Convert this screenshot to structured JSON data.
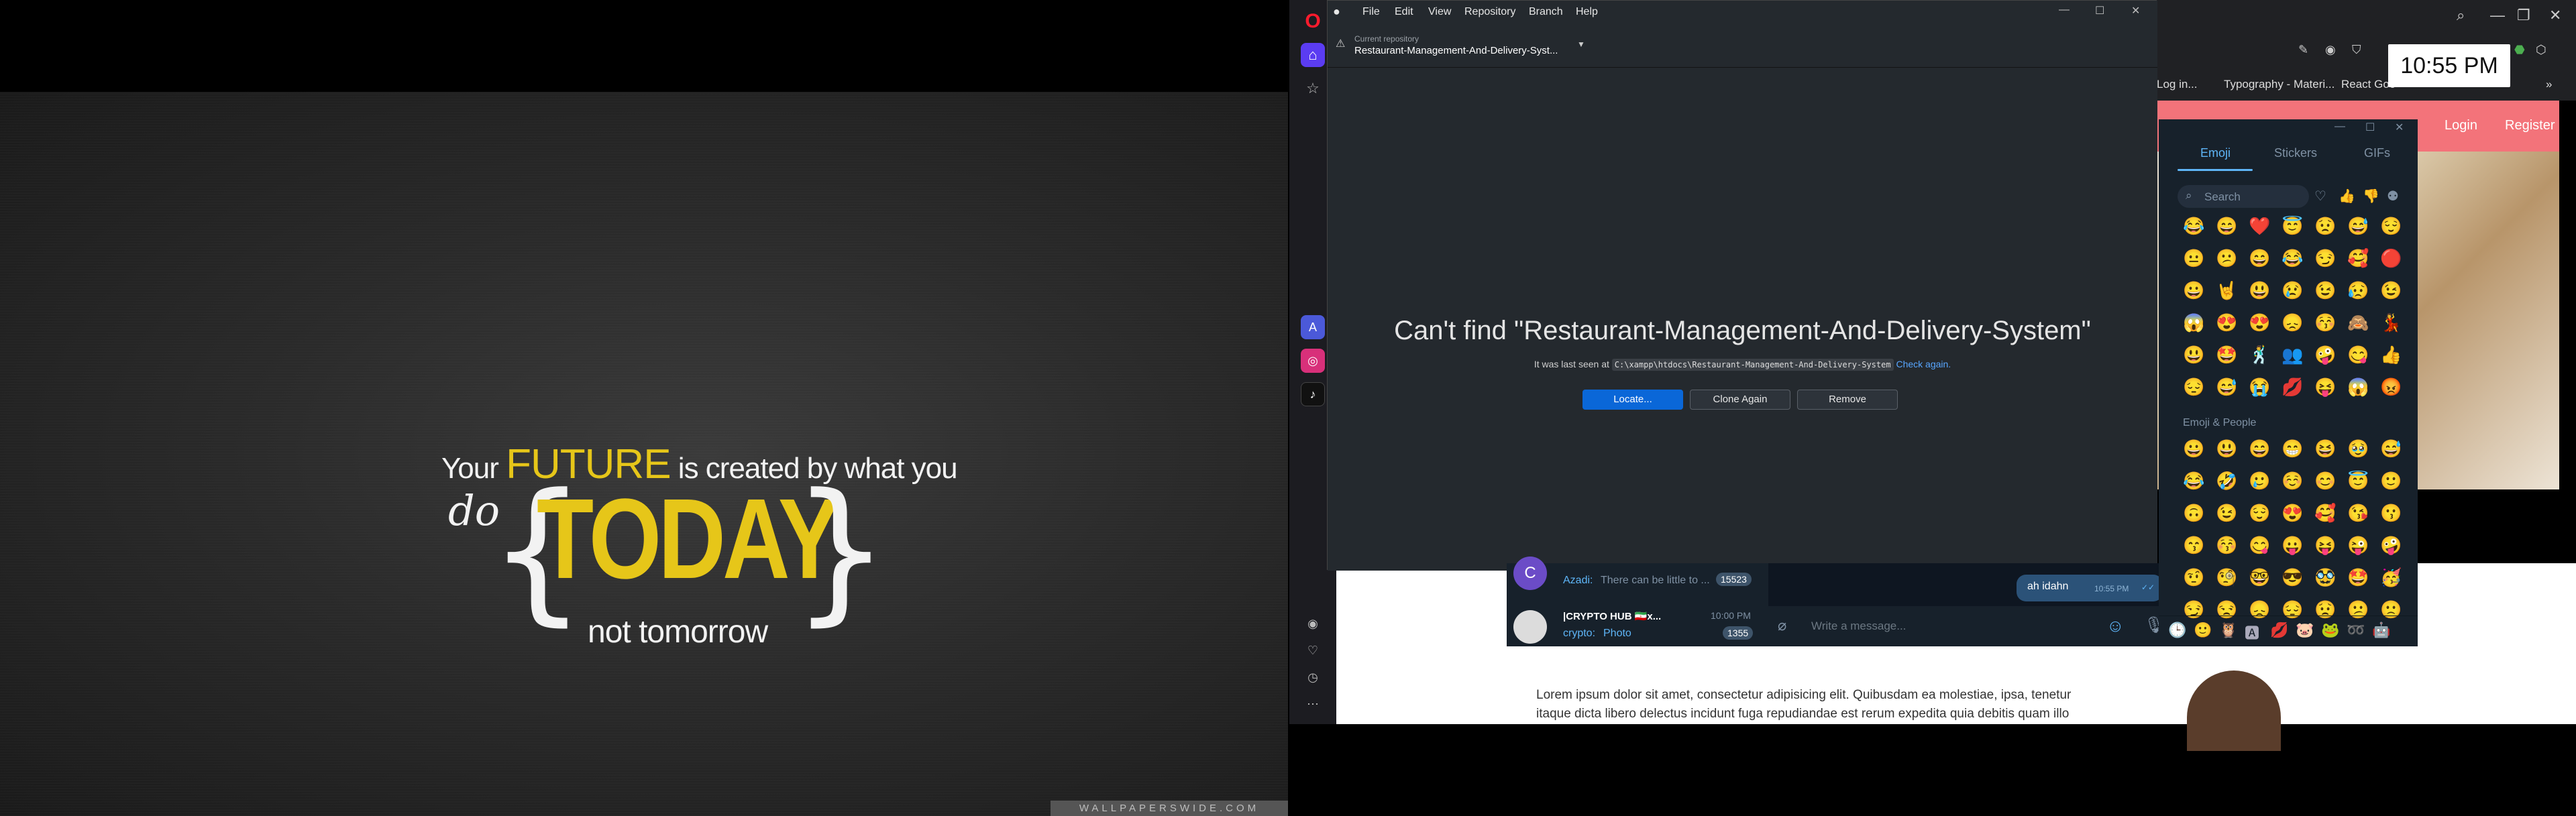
{
  "wallpaper": {
    "line1_a": "Your",
    "line1_highlight": "FUTURE",
    "line1_b": "is created by what you",
    "do": "do",
    "brace_open": "{",
    "today": "TODAY",
    "brace_close": "}",
    "tomorrow": "not tomorrow",
    "watermark": "WALLPAPERSWIDE.COM"
  },
  "github": {
    "menu": [
      "File",
      "Edit",
      "View",
      "Repository",
      "Branch",
      "Help"
    ],
    "current_repo_caption": "Current repository",
    "current_repo_name": "Restaurant-Management-And-Delivery-Syst...",
    "heading": "Can't find \"Restaurant-Management-And-Delivery-System\"",
    "last_seen_prefix": "It was last seen at",
    "last_seen_path": "C:\\xampp\\htdocs\\Restaurant-Management-And-Delivery-System",
    "check_again": "Check again.",
    "buttons": {
      "locate": "Locate...",
      "clone_again": "Clone Again",
      "remove": "Remove"
    }
  },
  "browser": {
    "bookmarks": [
      "Log in...",
      "Typography - Materi...",
      "React Goo"
    ],
    "clock": "10:55 PM",
    "nav": {
      "login": "Login",
      "register": "Register"
    },
    "lorem_line1": "Lorem ipsum dolor sit amet, consectetur adipisicing elit. Quibusdam ea molestiae, ipsa, tenetur",
    "lorem_line2": "itaque dicta libero delectus incidunt fuga repudiandae est rerum expedita quia debitis quam illo"
  },
  "telegram": {
    "chats": [
      {
        "sender": "Azadi:",
        "preview": "There can be little to ...",
        "badge": "15523",
        "avatar_letter": "C"
      },
      {
        "title": "|CRYPTO HUB 🇮🇷x...",
        "time": "10:00 PM",
        "sender": "crypto:",
        "preview": "Photo",
        "badge": "1355"
      }
    ],
    "bubble_text": "ah idahn",
    "bubble_time": "10:55 PM",
    "compose_placeholder": "Write a message..."
  },
  "emoji_panel": {
    "tabs": [
      "Emoji",
      "Stickers",
      "GIFs"
    ],
    "search_placeholder": "Search",
    "section_title": "Emoji & People",
    "recent": [
      "😂",
      "😄",
      "❤️",
      "😇",
      "😟",
      "😅",
      "😌",
      "😐",
      "😕",
      "😄",
      "😂",
      "😏",
      "🥰",
      "🔴",
      "😀",
      "🤘",
      "😃",
      "😢",
      "😉",
      "😥",
      "😉",
      "😱",
      "😍",
      "😍",
      "😞",
      "😚",
      "🙈",
      "💃",
      "😃",
      "🤩",
      "🕺",
      "👥",
      "🤪",
      "😋",
      "👍",
      "😔",
      "😅",
      "😭",
      "💋",
      "😝",
      "😱",
      "😡"
    ],
    "people": [
      "😀",
      "😃",
      "😄",
      "😁",
      "😆",
      "🥹",
      "😅",
      "😂",
      "🤣",
      "🥲",
      "☺️",
      "😊",
      "😇",
      "🙂",
      "🙃",
      "😉",
      "😌",
      "😍",
      "🥰",
      "😘",
      "😗",
      "😙",
      "😚",
      "😋",
      "😛",
      "😝",
      "😜",
      "🤪",
      "🤨",
      "🧐",
      "🤓",
      "😎",
      "🥸",
      "🤩",
      "🥳",
      "😏",
      "😒",
      "😞",
      "😔",
      "😟",
      "😕",
      "🙁"
    ],
    "bottom_icons": [
      "🕒",
      "🙂",
      "🦉",
      "🅰",
      "💋",
      "🐷",
      "🐸",
      "➿",
      "🤖"
    ]
  }
}
